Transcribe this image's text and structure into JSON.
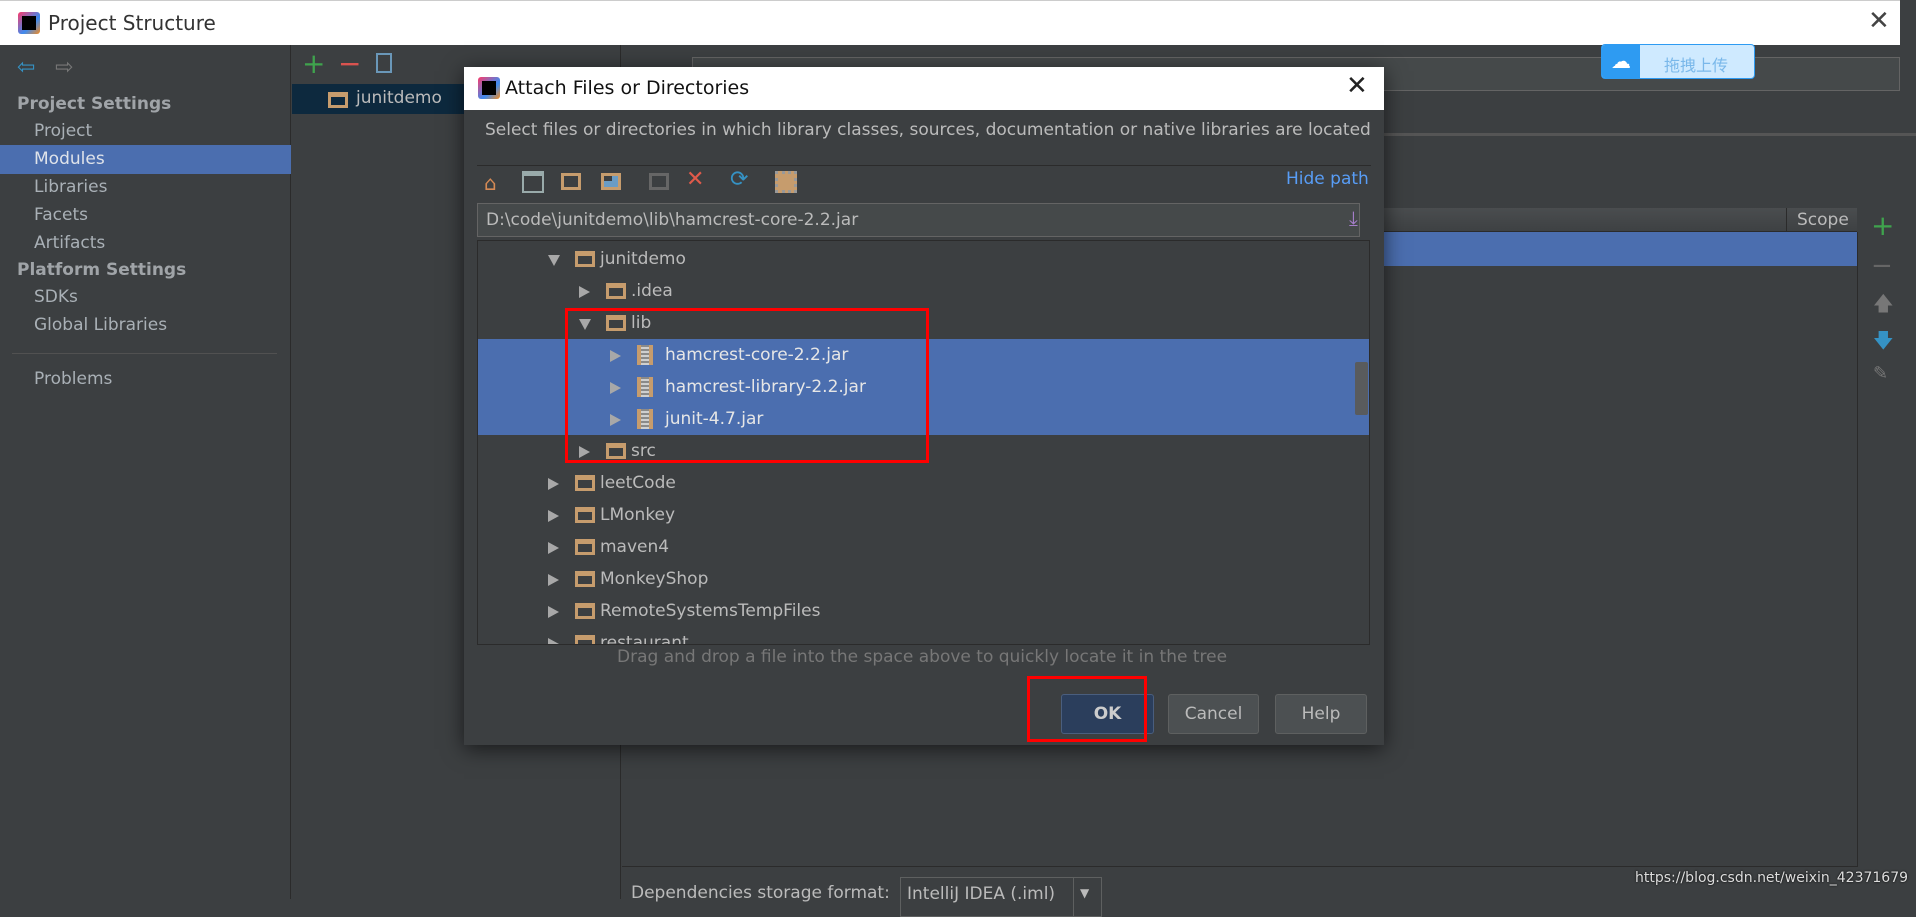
{
  "window": {
    "title": "Project Structure"
  },
  "sidebar": {
    "section1": "Project Settings",
    "items1": [
      {
        "label": "Project"
      },
      {
        "label": "Modules",
        "selected": true
      },
      {
        "label": "Libraries"
      },
      {
        "label": "Facets"
      },
      {
        "label": "Artifacts"
      }
    ],
    "section2": "Platform Settings",
    "items2": [
      {
        "label": "SDKs"
      },
      {
        "label": "Global Libraries"
      }
    ],
    "problems": "Problems"
  },
  "modules": {
    "items": [
      {
        "label": "junitdemo"
      }
    ]
  },
  "right_panel": {
    "scope_header": "Scope",
    "storage_label": "Dependencies storage format:",
    "storage_value": "IntelliJ IDEA (.iml)"
  },
  "overlay": {
    "baidu_upload": "拖拽上传",
    "watermark": "https://blog.csdn.net/weixin_42371679"
  },
  "dialog": {
    "title": "Attach Files or Directories",
    "description": "Select files or directories in which library classes, sources, documentation or native libraries are located",
    "hide_path": "Hide path",
    "path_value": "D:\\code\\junitdemo\\lib\\hamcrest-core-2.2.jar",
    "tree": [
      {
        "label": "junitdemo",
        "level": 0,
        "type": "folder",
        "expanded": true
      },
      {
        "label": ".idea",
        "level": 1,
        "type": "folder"
      },
      {
        "label": "lib",
        "level": 1,
        "type": "folder",
        "expanded": true
      },
      {
        "label": "hamcrest-core-2.2.jar",
        "level": 2,
        "type": "jar",
        "selected": true
      },
      {
        "label": "hamcrest-library-2.2.jar",
        "level": 2,
        "type": "jar",
        "selected": true
      },
      {
        "label": "junit-4.7.jar",
        "level": 2,
        "type": "jar",
        "selected": true
      },
      {
        "label": "src",
        "level": 1,
        "type": "folder"
      },
      {
        "label": "leetCode",
        "level": 0,
        "type": "folder"
      },
      {
        "label": "LMonkey",
        "level": 0,
        "type": "folder"
      },
      {
        "label": "maven4",
        "level": 0,
        "type": "folder"
      },
      {
        "label": "MonkeyShop",
        "level": 0,
        "type": "folder"
      },
      {
        "label": "RemoteSystemsTempFiles",
        "level": 0,
        "type": "folder"
      },
      {
        "label": "restaurant",
        "level": 0,
        "type": "folder"
      }
    ],
    "hint": "Drag and drop a file into the space above to quickly locate it in the tree",
    "ok": "OK",
    "cancel": "Cancel",
    "help": "Help"
  },
  "colors": {
    "selection": "#4b6eaf",
    "highlight_box": "#ff0000",
    "link": "#589df6"
  }
}
